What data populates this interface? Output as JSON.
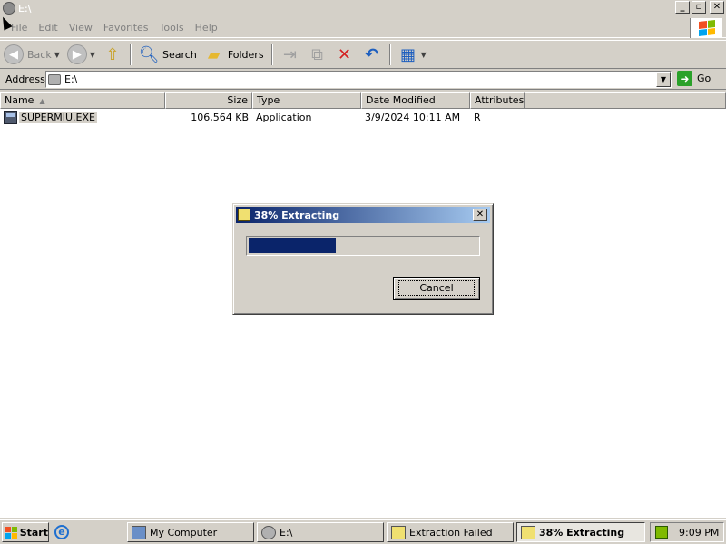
{
  "window": {
    "title": "E:\\"
  },
  "menubar": {
    "items": [
      "File",
      "Edit",
      "View",
      "Favorites",
      "Tools",
      "Help"
    ]
  },
  "toolbar": {
    "back_label": "Back",
    "search_label": "Search",
    "folders_label": "Folders"
  },
  "address": {
    "label": "Address",
    "value": "E:\\",
    "go_label": "Go"
  },
  "listview": {
    "columns": [
      "Name",
      "Size",
      "Type",
      "Date Modified",
      "Attributes"
    ],
    "rows": [
      {
        "name": "SUPERMIU.EXE",
        "size": "106,564 KB",
        "type": "Application",
        "modified": "3/9/2024 10:11 AM",
        "attributes": "R"
      }
    ]
  },
  "dialog": {
    "title": "38% Extracting",
    "progress": 0.38,
    "cancel_label": "Cancel"
  },
  "taskbar": {
    "start_label": "Start",
    "buttons": [
      {
        "label": "My Computer"
      },
      {
        "label": "E:\\"
      },
      {
        "label": "Extraction Failed"
      },
      {
        "label": "38% Extracting"
      }
    ],
    "clock": "9:09 PM"
  },
  "colors": {
    "selection": "#0a246a",
    "face": "#d4d0c8"
  },
  "icons": {
    "drive": "drive-icon",
    "exe": "exe-icon",
    "delete": "delete-icon",
    "undo": "undo-icon",
    "go": "go-arrow-icon"
  }
}
